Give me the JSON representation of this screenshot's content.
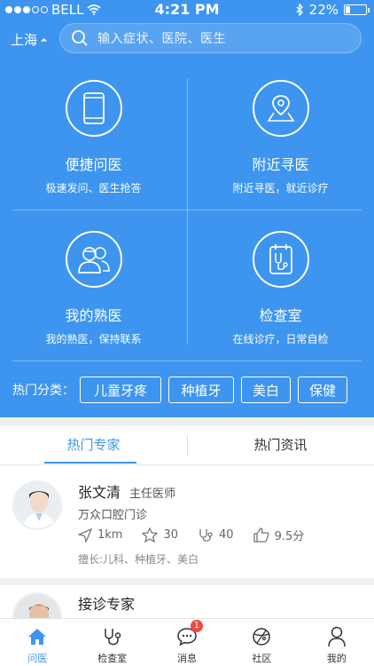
{
  "status_bar": {
    "carrier": "BELL",
    "time": "4:21 PM",
    "battery_text": "22%",
    "battery_level": 0.22
  },
  "header": {
    "city": "上海",
    "search_placeholder": "输入症状、医院、医生"
  },
  "services": [
    {
      "title": "便捷问医",
      "subtitle": "极速发问、医生抢答",
      "icon": "phone-icon"
    },
    {
      "title": "附近寻医",
      "subtitle": "附近寻医，就近诊疗",
      "icon": "map-pin-icon"
    },
    {
      "title": "我的熟医",
      "subtitle": "我的熟医，保持联系",
      "icon": "doctors-icon"
    },
    {
      "title": "检查室",
      "subtitle": "在线诊疗，日常自检",
      "icon": "stethoscope-icon"
    }
  ],
  "hot_categories": {
    "label": "热门分类：",
    "tags": [
      "儿童牙疼",
      "种植牙",
      "美白",
      "保健"
    ]
  },
  "tabs": {
    "experts": "热门专家",
    "news": "热门资讯"
  },
  "doctors": [
    {
      "name": "张文清",
      "title": "主任医师",
      "hospital": "万众口腔门诊",
      "distance": "1km",
      "favorites": "30",
      "consults": "40",
      "score": "9.5分",
      "specialty": "擅长:儿科、种植牙、美白"
    },
    {
      "name": "接诊专家"
    }
  ],
  "tabbar": [
    {
      "label": "问医",
      "icon": "home-icon"
    },
    {
      "label": "检查室",
      "icon": "stethoscope-icon"
    },
    {
      "label": "消息",
      "icon": "message-icon",
      "badge": "1"
    },
    {
      "label": "社区",
      "icon": "community-icon"
    },
    {
      "label": "我的",
      "icon": "user-icon"
    }
  ],
  "colors": {
    "primary": "#3d95ef",
    "badge": "#f04a3c"
  }
}
